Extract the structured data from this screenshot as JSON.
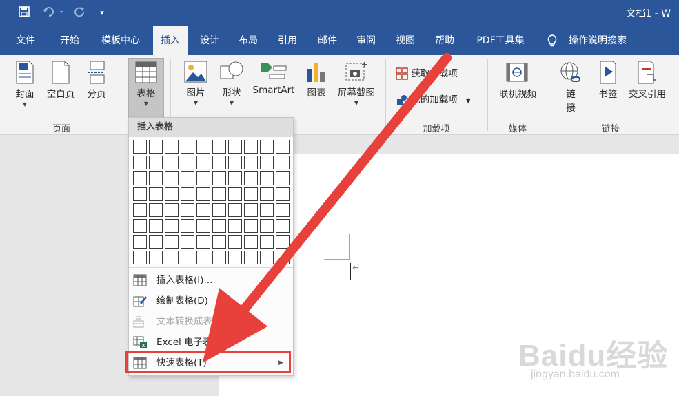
{
  "titlebar": {
    "title": "文档1 - W",
    "undo_icon": "undo-icon",
    "redo_icon": "redo-icon",
    "save_icon": "save-icon"
  },
  "tabs": [
    {
      "label": "文件"
    },
    {
      "label": "开始"
    },
    {
      "label": "模板中心"
    },
    {
      "label": "插入",
      "active": true
    },
    {
      "label": "设计"
    },
    {
      "label": "布局"
    },
    {
      "label": "引用"
    },
    {
      "label": "邮件"
    },
    {
      "label": "审阅"
    },
    {
      "label": "视图"
    },
    {
      "label": "帮助"
    },
    {
      "label": "PDF工具集"
    }
  ],
  "tell_me": {
    "label": "操作说明搜索"
  },
  "ribbon": {
    "pages_group": {
      "label": "页面",
      "cover": "封面",
      "blank": "空白页",
      "break": "分页"
    },
    "table_button": "表格",
    "illustrations": {
      "picture": "图片",
      "shape": "形状",
      "smartart": "SmartArt",
      "chart": "图表",
      "screenshot": "屏幕截图"
    },
    "addins_group": {
      "label": "加载项",
      "get": "获取加载项",
      "my": "我的加载项"
    },
    "media_group": {
      "label": "媒体",
      "online_video": "联机视频"
    },
    "links_group": {
      "label": "链接",
      "link_line1": "链",
      "link_line2": "接",
      "bookmark": "书签",
      "cross_ref": "交叉引用"
    }
  },
  "table_menu": {
    "header": "插入表格",
    "grid": {
      "columns": 10,
      "rows": 8
    },
    "items": [
      {
        "label": "插入表格(I)...",
        "enabled": true
      },
      {
        "label": "绘制表格(D)",
        "enabled": true
      },
      {
        "label": "文本转换成表格(V)...",
        "enabled": false
      },
      {
        "label": "Excel 电子表格(X)",
        "enabled": true
      },
      {
        "label": "快速表格(T)",
        "enabled": true,
        "submenu": true
      }
    ]
  },
  "colors": {
    "brand": "#2b579a",
    "annotation_red": "#e8403a"
  },
  "watermark": {
    "text": "Baidu经验",
    "url": "jingyan.baidu.com"
  }
}
